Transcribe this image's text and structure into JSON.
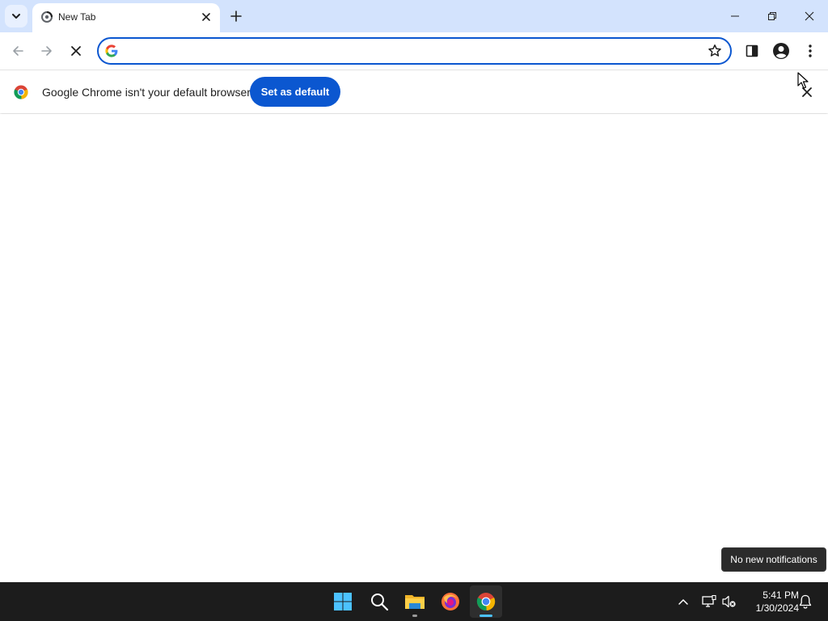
{
  "browser": {
    "tab": {
      "title": "New Tab"
    },
    "omnibox": {
      "value": "",
      "placeholder": ""
    },
    "infobar": {
      "message": "Google Chrome isn't your default browser",
      "button_label": "Set as default"
    }
  },
  "notification": {
    "text": "No new notifications"
  },
  "taskbar": {
    "apps": [
      "start-icon",
      "search-icon",
      "file-explorer-icon",
      "firefox-icon",
      "chrome-icon"
    ],
    "clock": {
      "time": "5:41 PM",
      "date": "1/30/2024"
    }
  },
  "colors": {
    "tabstrip_bg": "#d3e3fd",
    "accent": "#0b57d0",
    "taskbar_bg": "#1c1c1c",
    "taskbar_active_indicator": "#4cc2ff"
  }
}
